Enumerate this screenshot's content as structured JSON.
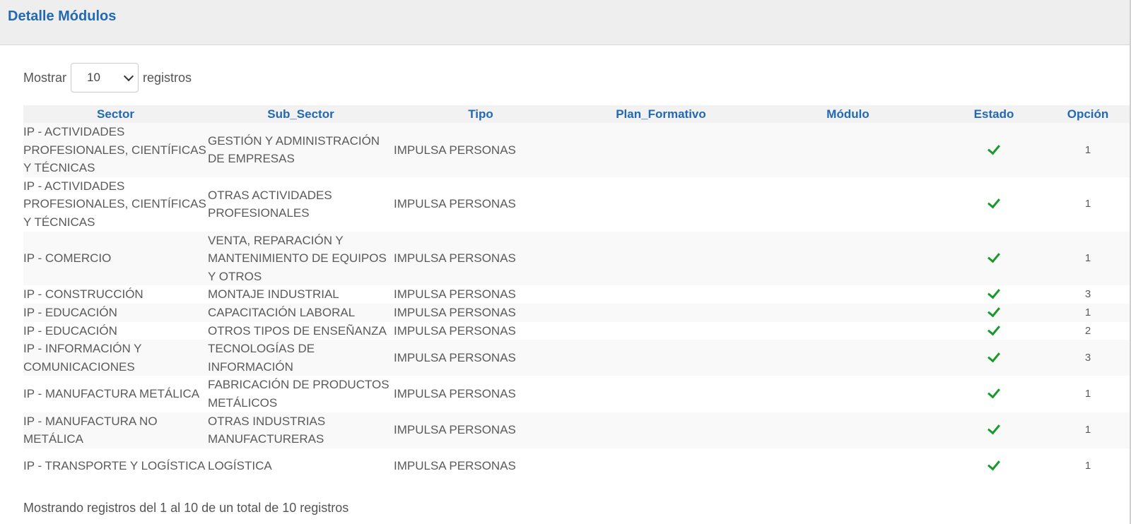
{
  "panel": {
    "title": "Detalle Módulos"
  },
  "length_menu": {
    "prefix": "Mostrar",
    "selected": "10",
    "suffix": "registros"
  },
  "table": {
    "headers": [
      "Sector",
      "Sub_Sector",
      "Tipo",
      "Plan_Formativo",
      "Módulo",
      "Estado",
      "Opción"
    ],
    "rows": [
      [
        "IP - ACTIVIDADES PROFESIONALES, CIENTÍFICAS Y TÉCNICAS",
        "GESTIÓN Y ADMINISTRACIÓN DE EMPRESAS",
        "IMPULSA PERSONAS",
        "",
        "",
        "check-icon",
        "1"
      ],
      [
        "IP - ACTIVIDADES PROFESIONALES, CIENTÍFICAS Y TÉCNICAS",
        "OTRAS ACTIVIDADES PROFESIONALES",
        "IMPULSA PERSONAS",
        "",
        "",
        "check-icon",
        "1"
      ],
      [
        "IP - COMERCIO",
        "VENTA, REPARACIÓN Y MANTENIMIENTO DE EQUIPOS Y OTROS",
        "IMPULSA PERSONAS",
        "",
        "",
        "check-icon",
        "1"
      ],
      [
        "IP - CONSTRUCCIÓN",
        "MONTAJE INDUSTRIAL",
        "IMPULSA PERSONAS",
        "",
        "",
        "check-icon",
        "3"
      ],
      [
        "IP - EDUCACIÓN",
        "CAPACITACIÓN LABORAL",
        "IMPULSA PERSONAS",
        "",
        "",
        "check-icon",
        "1"
      ],
      [
        "IP - EDUCACIÓN",
        "OTROS TIPOS DE ENSEÑANZA",
        "IMPULSA PERSONAS",
        "",
        "",
        "check-icon",
        "2"
      ],
      [
        "IP - INFORMACIÓN Y COMUNICACIONES",
        "TECNOLOGÍAS DE INFORMACIÓN",
        "IMPULSA PERSONAS",
        "",
        "",
        "check-icon",
        "3"
      ],
      [
        "IP - MANUFACTURA METÁLICA",
        "FABRICACIÓN DE PRODUCTOS METÁLICOS",
        "IMPULSA PERSONAS",
        "",
        "",
        "check-icon",
        "1"
      ],
      [
        "IP - MANUFACTURA NO METÁLICA",
        "OTRAS INDUSTRIAS MANUFACTURERAS",
        "IMPULSA PERSONAS",
        "",
        "",
        "check-icon",
        "1"
      ],
      [
        "IP - TRANSPORTE Y LOGÍSTICA",
        "LOGÍSTICA",
        "IMPULSA PERSONAS",
        "",
        "",
        "check-icon",
        "1"
      ]
    ]
  },
  "footer": {
    "info": "Mostrando registros del 1 al 10 de un total de 10 registros"
  },
  "colors": {
    "header_text": "#2269b3",
    "check": "#1a9a2b",
    "header_bar": "#eeeeee"
  }
}
